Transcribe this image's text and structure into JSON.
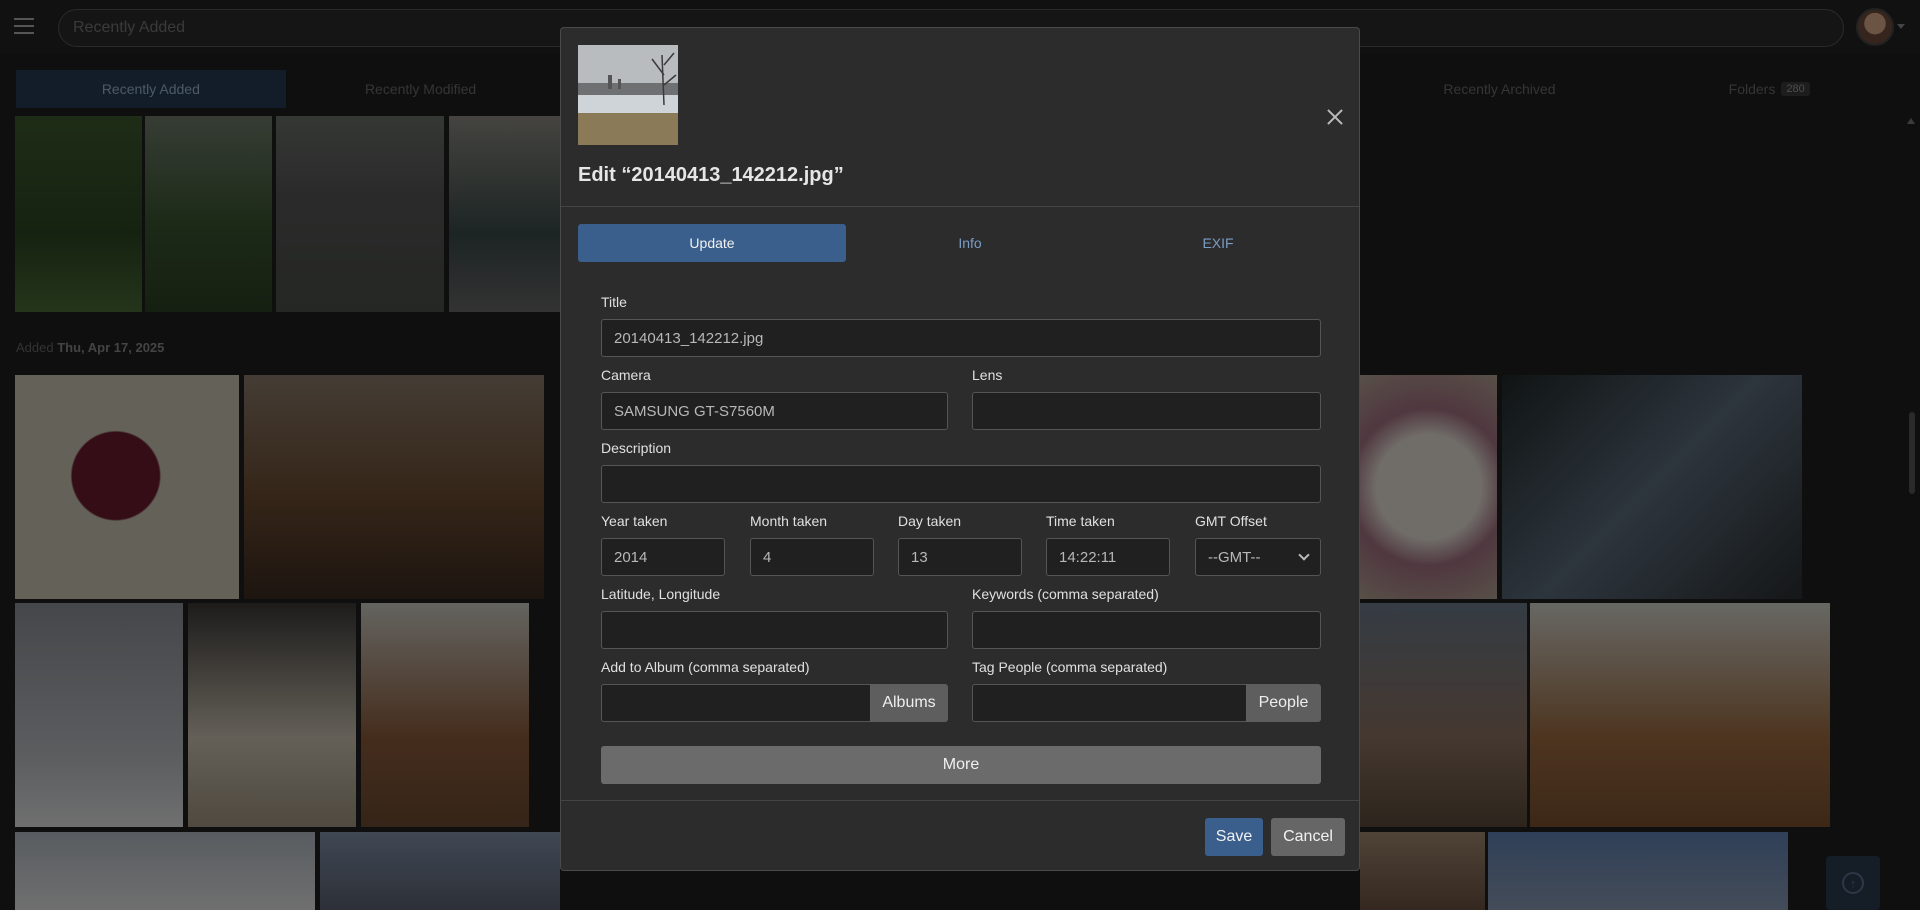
{
  "search": {
    "placeholder": "Recently Added"
  },
  "tabs": [
    {
      "label": "Recently Added",
      "active": true
    },
    {
      "label": "Recently Modified"
    },
    {
      "label": ""
    },
    {
      "label": ""
    },
    {
      "label": ""
    },
    {
      "label": "Recently Archived"
    },
    {
      "label": "Folders",
      "count": "280"
    }
  ],
  "date_group": {
    "prefix": "Added",
    "date": "Thu, Apr 17, 2025"
  },
  "modal": {
    "title": "Edit “20140413_142212.jpg”",
    "tabs": {
      "update": "Update",
      "info": "Info",
      "exif": "EXIF"
    },
    "fields": {
      "title": {
        "label": "Title",
        "value": "20140413_142212.jpg"
      },
      "camera": {
        "label": "Camera",
        "value": "SAMSUNG GT-S7560M"
      },
      "lens": {
        "label": "Lens",
        "value": ""
      },
      "description": {
        "label": "Description",
        "value": ""
      },
      "year": {
        "label": "Year taken",
        "value": "2014"
      },
      "month": {
        "label": "Month taken",
        "value": "4"
      },
      "day": {
        "label": "Day taken",
        "value": "13"
      },
      "time": {
        "label": "Time taken",
        "value": "14:22:11"
      },
      "gmt": {
        "label": "GMT Offset",
        "value": "--GMT--"
      },
      "latlng": {
        "label": "Latitude, Longitude",
        "value": ""
      },
      "keywords": {
        "label": "Keywords (comma separated)",
        "value": ""
      },
      "album": {
        "label": "Add to Album (comma separated)",
        "value": "",
        "button": "Albums"
      },
      "people": {
        "label": "Tag People (comma separated)",
        "value": "",
        "button": "People"
      }
    },
    "more_label": "More",
    "save_label": "Save",
    "cancel_label": "Cancel"
  },
  "colors": {
    "accent": "#3b5f8c",
    "link": "#7a9cc3",
    "modal_bg": "#2c2c2c"
  }
}
